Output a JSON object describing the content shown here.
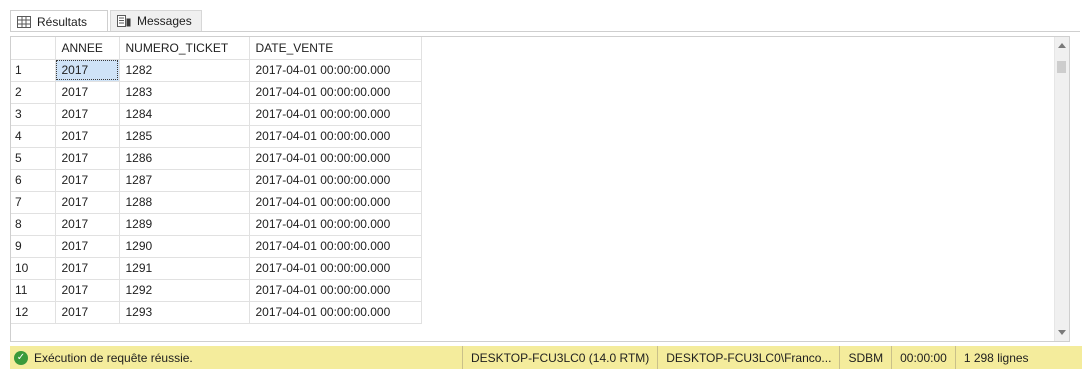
{
  "tabs": {
    "results_label": "Résultats",
    "messages_label": "Messages"
  },
  "grid": {
    "columns": [
      "ANNEE",
      "NUMERO_TICKET",
      "DATE_VENTE"
    ],
    "rows": [
      [
        "1",
        "2017",
        "1282",
        "2017-04-01 00:00:00.000"
      ],
      [
        "2",
        "2017",
        "1283",
        "2017-04-01 00:00:00.000"
      ],
      [
        "3",
        "2017",
        "1284",
        "2017-04-01 00:00:00.000"
      ],
      [
        "4",
        "2017",
        "1285",
        "2017-04-01 00:00:00.000"
      ],
      [
        "5",
        "2017",
        "1286",
        "2017-04-01 00:00:00.000"
      ],
      [
        "6",
        "2017",
        "1287",
        "2017-04-01 00:00:00.000"
      ],
      [
        "7",
        "2017",
        "1288",
        "2017-04-01 00:00:00.000"
      ],
      [
        "8",
        "2017",
        "1289",
        "2017-04-01 00:00:00.000"
      ],
      [
        "9",
        "2017",
        "1290",
        "2017-04-01 00:00:00.000"
      ],
      [
        "10",
        "2017",
        "1291",
        "2017-04-01 00:00:00.000"
      ],
      [
        "11",
        "2017",
        "1292",
        "2017-04-01 00:00:00.000"
      ],
      [
        "12",
        "2017",
        "1293",
        "2017-04-01 00:00:00.000"
      ]
    ]
  },
  "status": {
    "message": "Exécution de requête réussie.",
    "server": "DESKTOP-FCU3LC0 (14.0 RTM)",
    "user": "DESKTOP-FCU3LC0\\Franco...",
    "database": "SDBM",
    "elapsed": "00:00:00",
    "rows": "1 298 lignes"
  },
  "colors": {
    "status_bg": "#f4ec9c",
    "selected_cell": "#cfe3f7",
    "ok_icon": "#3a9a3a"
  }
}
